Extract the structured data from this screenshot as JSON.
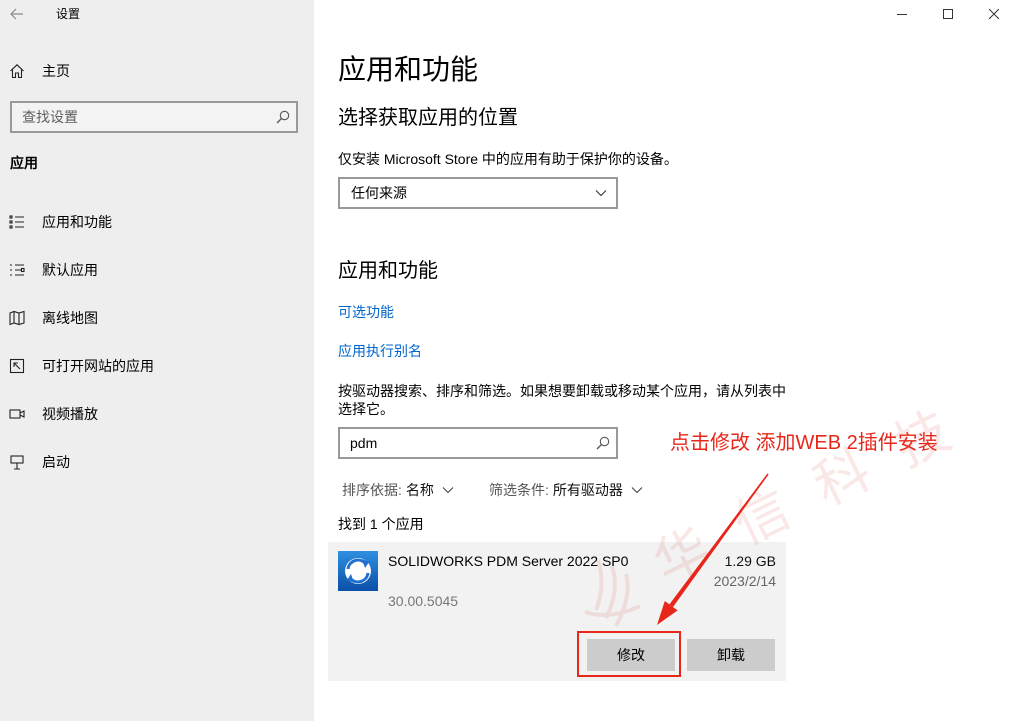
{
  "window": {
    "title": "设置",
    "back_icon": "back-arrow-icon",
    "controls": [
      "minimize-icon",
      "maximize-icon",
      "close-icon"
    ]
  },
  "sidebar": {
    "home_label": "主页",
    "home_icon": "home-icon",
    "search_placeholder": "查找设置",
    "section_title": "应用",
    "items": [
      {
        "label": "应用和功能",
        "icon": "apps-features-icon"
      },
      {
        "label": "默认应用",
        "icon": "default-apps-icon"
      },
      {
        "label": "离线地图",
        "icon": "offline-maps-icon"
      },
      {
        "label": "可打开网站的应用",
        "icon": "apps-for-websites-icon"
      },
      {
        "label": "视频播放",
        "icon": "video-playback-icon"
      },
      {
        "label": "启动",
        "icon": "startup-icon"
      }
    ]
  },
  "main": {
    "page_title": "应用和功能",
    "install_source": {
      "heading": "选择获取应用的位置",
      "description": "仅安装 Microsoft Store 中的应用有助于保护你的设备。",
      "selected": "任何来源"
    },
    "apps_section": {
      "heading": "应用和功能",
      "links": [
        "可选功能",
        "应用执行别名"
      ],
      "description": "按驱动器搜索、排序和筛选。如果想要卸载或移动某个应用，请从列表中选择它。",
      "search_value": "pdm",
      "sort_label": "排序依据:",
      "sort_value": "名称",
      "filter_label": "筛选条件:",
      "filter_value": "所有驱动器",
      "result_count": "找到 1 个应用",
      "apps": [
        {
          "name": "SOLIDWORKS PDM Server 2022 SP0",
          "size": "1.29 GB",
          "date": "2023/2/14",
          "version": "30.00.5045",
          "icon": "solidworks-pdm-icon"
        }
      ],
      "modify_label": "修改",
      "uninstall_label": "卸载"
    }
  },
  "annotation": {
    "text": "点击修改 添加WEB 2插件安装",
    "color": "#e8271a"
  },
  "watermark": {
    "text": "华信科技",
    "color": "#d02a20"
  },
  "colors": {
    "link": "#0066cc",
    "sidebar_bg": "#eeeeee",
    "button_bg": "#cccccc"
  }
}
